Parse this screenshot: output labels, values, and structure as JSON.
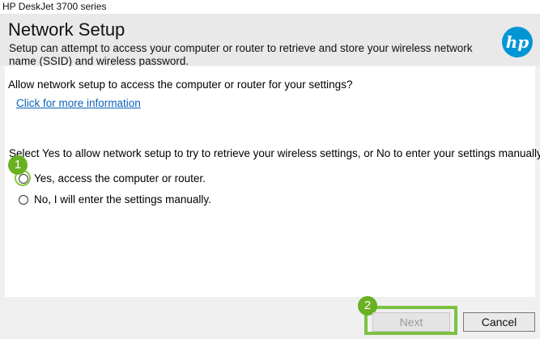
{
  "window": {
    "title": "HP DeskJet 3700 series"
  },
  "header": {
    "title": "Network Setup",
    "description": "Setup can attempt to access your computer or router to retrieve and store your wireless network name (SSID) and wireless password.",
    "logo_text": "hp",
    "logo_color": "#0096d6"
  },
  "main": {
    "question": "Allow network setup to access the computer or router for your settings?",
    "more_info_link": "Click for more information",
    "instruction": "Select Yes to allow network setup to try to retrieve your wireless settings, or No to enter your settings manually.",
    "options": [
      {
        "label": "Yes, access the computer or router.",
        "selected": false
      },
      {
        "label": "No, I will enter the settings manually.",
        "selected": false
      }
    ]
  },
  "annotations": {
    "step1": "1",
    "step2": "2",
    "highlight_color": "#7cc242"
  },
  "footer": {
    "next_label": "Next",
    "next_enabled": false,
    "cancel_label": "Cancel"
  }
}
